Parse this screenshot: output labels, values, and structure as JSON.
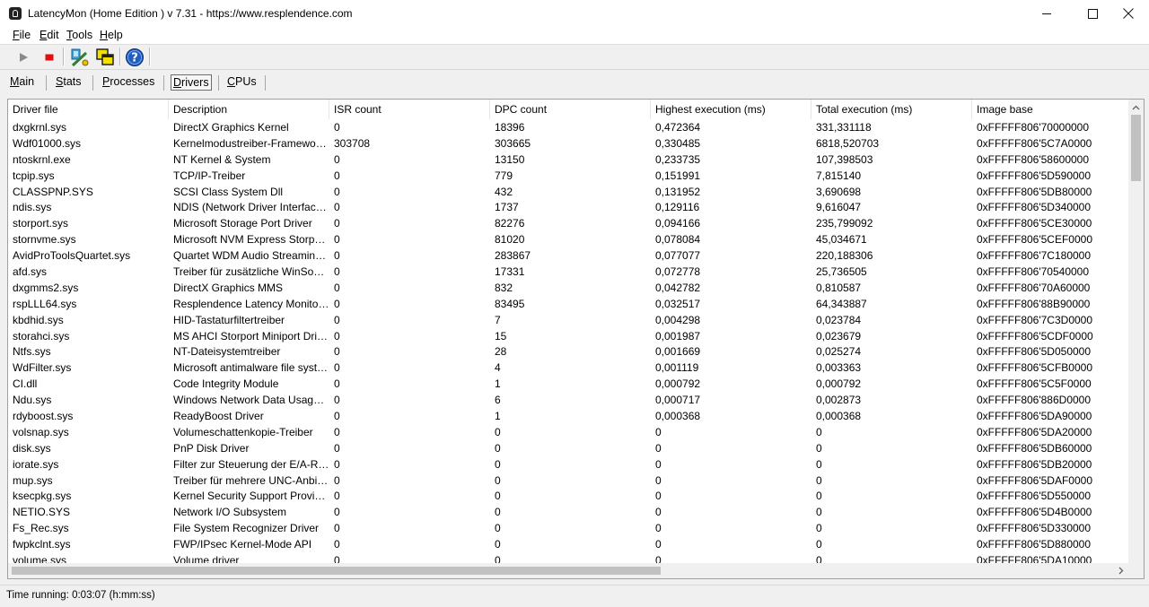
{
  "window": {
    "title": "LatencyMon  (Home Edition )  v 7.31 - https://www.resplendence.com"
  },
  "menu": [
    {
      "accel": "F",
      "rest": "ile"
    },
    {
      "accel": "E",
      "rest": "dit"
    },
    {
      "accel": "T",
      "rest": "ools"
    },
    {
      "accel": "H",
      "rest": "elp"
    }
  ],
  "toolbar": {
    "buttons": [
      "play-icon",
      "stop-icon",
      "analyze-icon",
      "windows-icon",
      "help-icon"
    ]
  },
  "tabs": [
    {
      "accel": "M",
      "rest": "ain",
      "active": false
    },
    {
      "accel": "S",
      "rest": "tats",
      "active": false
    },
    {
      "accel": "P",
      "rest": "rocesses",
      "active": false
    },
    {
      "accel": "D",
      "rest": "rivers",
      "active": true
    },
    {
      "accel": "C",
      "rest": "PUs",
      "active": false
    }
  ],
  "table": {
    "columns": [
      "Driver file",
      "Description",
      "ISR count",
      "DPC count",
      "Highest execution (ms)",
      "Total execution (ms)",
      "Image base"
    ],
    "rows": [
      [
        "dxgkrnl.sys",
        "DirectX Graphics Kernel",
        "0",
        "18396",
        "0,472364",
        "331,331118",
        "0xFFFFF806'70000000"
      ],
      [
        "Wdf01000.sys",
        "Kernelmodustreiber-Framework-Laufzeit",
        "303708",
        "303665",
        "0,330485",
        "6818,520703",
        "0xFFFFF806'5C7A0000"
      ],
      [
        "ntoskrnl.exe",
        "NT Kernel & System",
        "0",
        "13150",
        "0,233735",
        "107,398503",
        "0xFFFFF806'58600000"
      ],
      [
        "tcpip.sys",
        "TCP/IP-Treiber",
        "0",
        "779",
        "0,151991",
        "7,815140",
        "0xFFFFF806'5D590000"
      ],
      [
        "CLASSPNP.SYS",
        "SCSI Class System Dll",
        "0",
        "432",
        "0,131952",
        "3,690698",
        "0xFFFFF806'5DB80000"
      ],
      [
        "ndis.sys",
        "NDIS (Network Driver Interface Specification)",
        "0",
        "1737",
        "0,129116",
        "9,616047",
        "0xFFFFF806'5D340000"
      ],
      [
        "storport.sys",
        "Microsoft Storage Port Driver",
        "0",
        "82276",
        "0,094166",
        "235,799092",
        "0xFFFFF806'5CE30000"
      ],
      [
        "stornvme.sys",
        "Microsoft NVM Express Storport Miniport Driver",
        "0",
        "81020",
        "0,078084",
        "45,034671",
        "0xFFFFF806'5CEF0000"
      ],
      [
        "AvidProToolsQuartet.sys",
        "Quartet WDM Audio Streaming Driver",
        "0",
        "283867",
        "0,077077",
        "220,188306",
        "0xFFFFF806'7C180000"
      ],
      [
        "afd.sys",
        "Treiber für zusätzliche WinSock-Funktionen",
        "0",
        "17331",
        "0,072778",
        "25,736505",
        "0xFFFFF806'70540000"
      ],
      [
        "dxgmms2.sys",
        "DirectX Graphics MMS",
        "0",
        "832",
        "0,042782",
        "0,810587",
        "0xFFFFF806'70A60000"
      ],
      [
        "rspLLL64.sys",
        "Resplendence Latency Monitoring and Auxiliary Kernel Library",
        "0",
        "83495",
        "0,032517",
        "64,343887",
        "0xFFFFF806'88B90000"
      ],
      [
        "kbdhid.sys",
        "HID-Tastaturfiltertreiber",
        "0",
        "7",
        "0,004298",
        "0,023784",
        "0xFFFFF806'7C3D0000"
      ],
      [
        "storahci.sys",
        "MS AHCI Storport Miniport Driver",
        "0",
        "15",
        "0,001987",
        "0,023679",
        "0xFFFFF806'5CDF0000"
      ],
      [
        "Ntfs.sys",
        "NT-Dateisystemtreiber",
        "0",
        "28",
        "0,001669",
        "0,025274",
        "0xFFFFF806'5D050000"
      ],
      [
        "WdFilter.sys",
        "Microsoft antimalware file system filter driver",
        "0",
        "4",
        "0,001119",
        "0,003363",
        "0xFFFFF806'5CFB0000"
      ],
      [
        "CI.dll",
        "Code Integrity Module",
        "0",
        "1",
        "0,000792",
        "0,000792",
        "0xFFFFF806'5C5F0000"
      ],
      [
        "Ndu.sys",
        "Windows Network Data Usage Monitoring Driver",
        "0",
        "6",
        "0,000717",
        "0,002873",
        "0xFFFFF806'886D0000"
      ],
      [
        "rdyboost.sys",
        "ReadyBoost Driver",
        "0",
        "1",
        "0,000368",
        "0,000368",
        "0xFFFFF806'5DA90000"
      ],
      [
        "volsnap.sys",
        "Volumeschattenkopie-Treiber",
        "0",
        "0",
        "0",
        "0",
        "0xFFFFF806'5DA20000"
      ],
      [
        "disk.sys",
        "PnP Disk Driver",
        "0",
        "0",
        "0",
        "0",
        "0xFFFFF806'5DB60000"
      ],
      [
        "iorate.sys",
        "Filter zur Steuerung der E/A-Rate",
        "0",
        "0",
        "0",
        "0",
        "0xFFFFF806'5DB20000"
      ],
      [
        "mup.sys",
        "Treiber für mehrere UNC-Anbieter",
        "0",
        "0",
        "0",
        "0",
        "0xFFFFF806'5DAF0000"
      ],
      [
        "ksecpkg.sys",
        "Kernel Security Support Provider Interface Packages",
        "0",
        "0",
        "0",
        "0",
        "0xFFFFF806'5D550000"
      ],
      [
        "NETIO.SYS",
        "Network I/O Subsystem",
        "0",
        "0",
        "0",
        "0",
        "0xFFFFF806'5D4B0000"
      ],
      [
        "Fs_Rec.sys",
        "File System Recognizer Driver",
        "0",
        "0",
        "0",
        "0",
        "0xFFFFF806'5D330000"
      ],
      [
        "fwpkclnt.sys",
        "FWP/IPsec Kernel-Mode API",
        "0",
        "0",
        "0",
        "0",
        "0xFFFFF806'5D880000"
      ],
      [
        "volume.sys",
        "Volume driver",
        "0",
        "0",
        "0",
        "0",
        "0xFFFFF806'5DA10000"
      ]
    ]
  },
  "status": {
    "text": "Time running: 0:03:07  (h:mm:ss)"
  }
}
